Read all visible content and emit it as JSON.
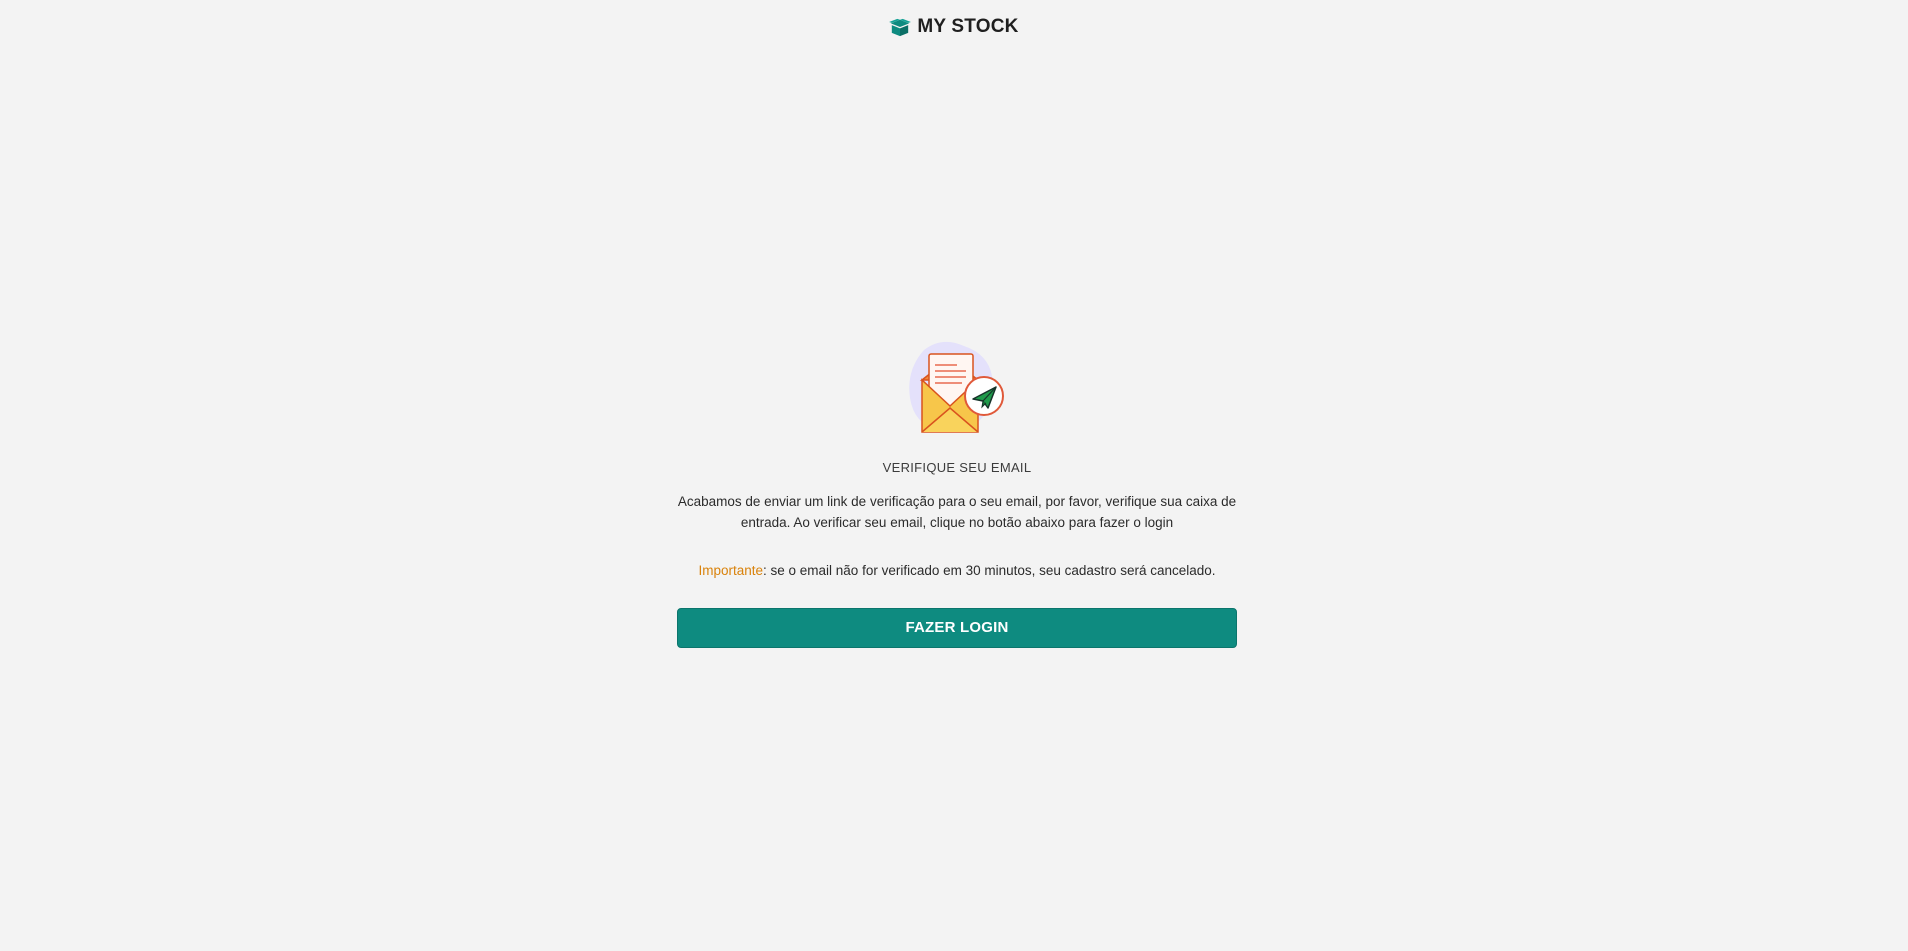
{
  "brand": {
    "name": "MY STOCK",
    "icon": "open-box-icon",
    "color": "#0e8b80"
  },
  "verification": {
    "illustration": "email-sent-icon",
    "heading": "VERIFIQUE SEU EMAIL",
    "message": "Acabamos de enviar um link de verificação para o seu email, por favor, verifique sua caixa de entrada. Ao verificar seu email, clique no botão abaixo para fazer o login",
    "note_label": "Importante",
    "note_text": ": se o email não for verificado em 30 minutos, seu cadastro será cancelado.",
    "note_label_color": "#d9820b"
  },
  "actions": {
    "login_label": "FAZER LOGIN",
    "button_color": "#0e8b80"
  }
}
